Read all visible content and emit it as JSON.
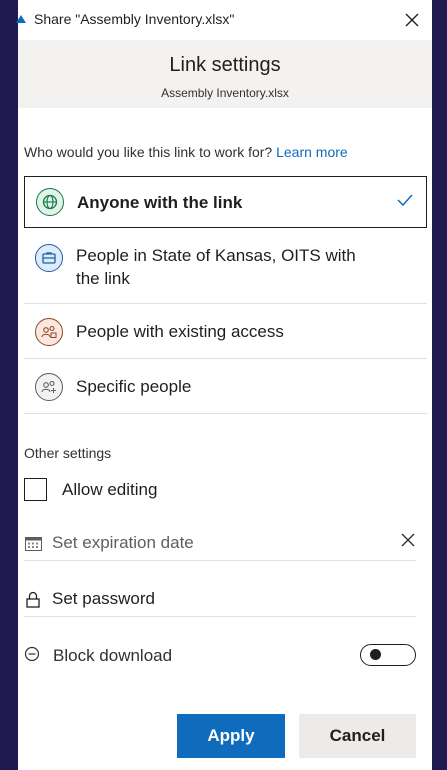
{
  "window": {
    "title": "Share \"Assembly Inventory.xlsx\"",
    "close_icon": "close-icon"
  },
  "header": {
    "title": "Link settings",
    "subtitle": "Assembly Inventory.xlsx"
  },
  "audience": {
    "question": "Who would you like this link to work for?",
    "learn_more": "Learn more",
    "options": [
      {
        "label": "Anyone with the link",
        "icon": "globe-icon",
        "selected": true
      },
      {
        "label": "People in State of Kansas, OITS with the link",
        "icon": "building-icon",
        "selected": false
      },
      {
        "label": "People with existing access",
        "icon": "people-icon",
        "selected": false
      },
      {
        "label": "Specific people",
        "icon": "person-add-icon",
        "selected": false
      }
    ]
  },
  "other_settings": {
    "title": "Other settings",
    "allow_editing": {
      "label": "Allow editing",
      "checked": false
    },
    "expiration": {
      "placeholder": "Set expiration date"
    },
    "password": {
      "label": "Set password"
    },
    "block_download": {
      "label": "Block download",
      "on": false
    }
  },
  "buttons": {
    "apply": "Apply",
    "cancel": "Cancel"
  },
  "colors": {
    "accent": "#0f6cbd",
    "backdrop": "#1f1a4f",
    "globe_bg": "#e0f2e9",
    "globe_fg": "#107c41",
    "building_bg": "#deecf9",
    "building_fg": "#1f5fa8",
    "people_bg": "#fbe7de",
    "people_fg": "#8a4a2a"
  }
}
